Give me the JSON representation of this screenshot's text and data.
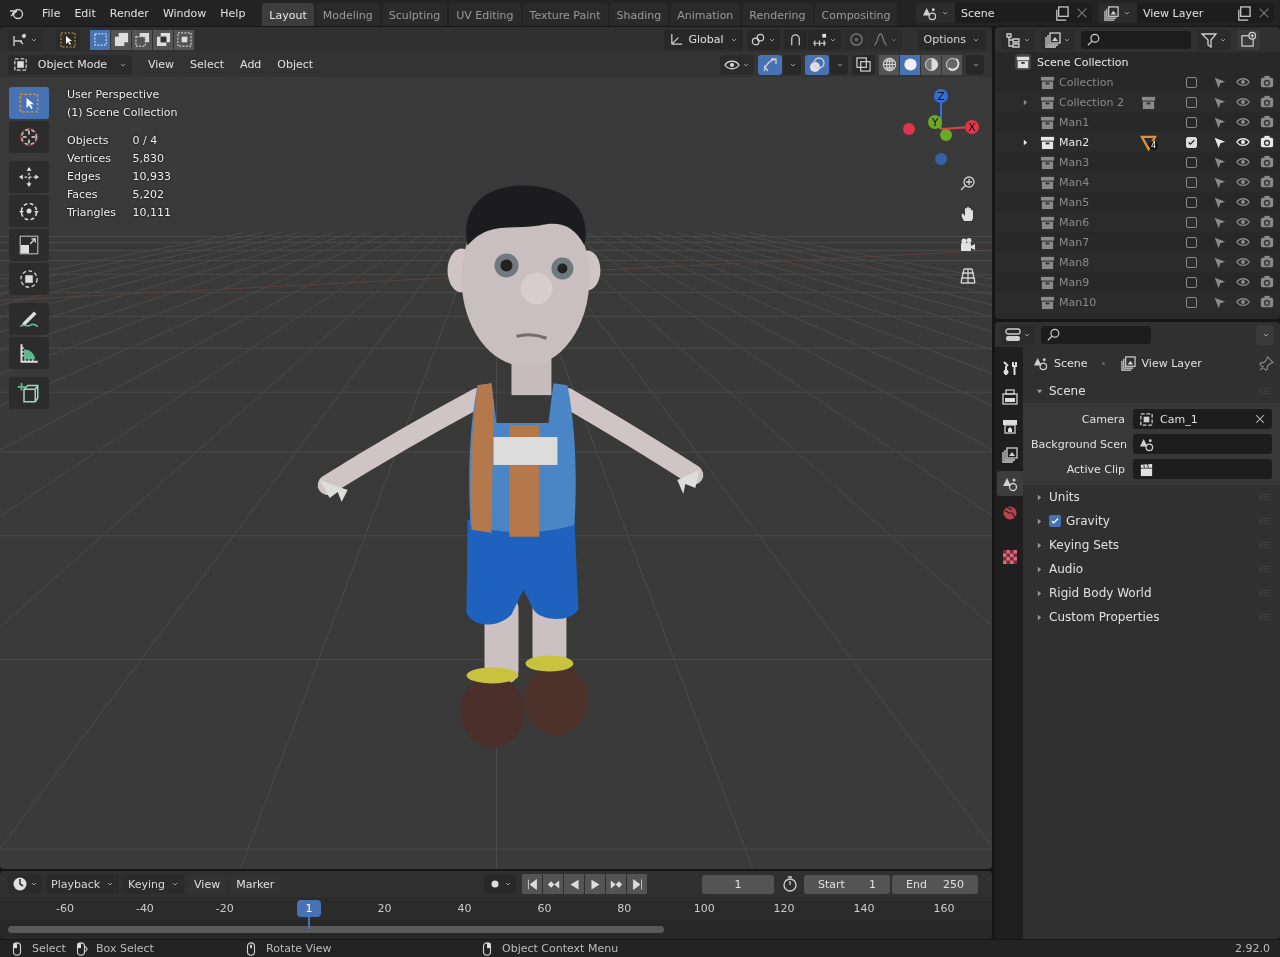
{
  "top_bar": {
    "menus": [
      "File",
      "Edit",
      "Render",
      "Window",
      "Help"
    ],
    "workspaces": [
      {
        "label": "Layout",
        "selected": true
      },
      {
        "label": "Modeling",
        "selected": false
      },
      {
        "label": "Sculpting",
        "selected": false
      },
      {
        "label": "UV Editing",
        "selected": false
      },
      {
        "label": "Texture Paint",
        "selected": false
      },
      {
        "label": "Shading",
        "selected": false
      },
      {
        "label": "Animation",
        "selected": false
      },
      {
        "label": "Rendering",
        "selected": false
      },
      {
        "label": "Compositing",
        "selected": false
      }
    ],
    "scene": "Scene",
    "view_layer": "View Layer"
  },
  "tool_header": {
    "select_modes": [
      {
        "kind": "set",
        "selected": true
      },
      {
        "kind": "extend",
        "selected": false
      },
      {
        "kind": "subtract",
        "selected": false
      },
      {
        "kind": "invert",
        "selected": false
      },
      {
        "kind": "intersect",
        "selected": false
      }
    ],
    "orientation": "Global",
    "options": "Options"
  },
  "viewport_header": {
    "mode": "Object Mode",
    "menus": [
      "View",
      "Select",
      "Add",
      "Object"
    ],
    "show_gizmos": true,
    "show_overlays": true,
    "shading": [
      {
        "kind": "wireframe",
        "selected": false
      },
      {
        "kind": "solid",
        "selected": true
      },
      {
        "kind": "material",
        "selected": false
      },
      {
        "kind": "rendered",
        "selected": false
      }
    ]
  },
  "toolbar": [
    {
      "kind": "select_box",
      "selected": true
    },
    {
      "kind": "cursor",
      "selected": false
    },
    {
      "kind": "move",
      "selected": false
    },
    {
      "kind": "rotate",
      "selected": false
    },
    {
      "kind": "scale",
      "selected": false
    },
    {
      "kind": "transform",
      "selected": false
    },
    {
      "kind": "annotate",
      "selected": false
    },
    {
      "kind": "measure",
      "selected": false
    },
    {
      "kind": "add_cube",
      "selected": false
    }
  ],
  "overlay_text": {
    "view": "User Perspective",
    "collection": "(1) Scene Collection",
    "stats": [
      {
        "label": "Objects",
        "value": "0 / 4"
      },
      {
        "label": "Vertices",
        "value": "5,830"
      },
      {
        "label": "Edges",
        "value": "10,933"
      },
      {
        "label": "Faces",
        "value": "5,202"
      },
      {
        "label": "Triangles",
        "value": "10,111"
      }
    ]
  },
  "axis_gizmo": {
    "x": "X",
    "y": "Y",
    "z": "Z"
  },
  "outliner": {
    "root": "Scene Collection",
    "items": [
      {
        "name": "Collection",
        "expander": false,
        "checked": false
      },
      {
        "name": "Collection 2",
        "expander": true,
        "checked": false,
        "extra": {
          "kind": "collection"
        }
      },
      {
        "name": "Man1",
        "expander": false,
        "checked": false
      },
      {
        "name": "Man2",
        "expander": true,
        "checked": true,
        "extra": {
          "kind": "mesh",
          "count": "4"
        }
      },
      {
        "name": "Man3",
        "expander": false,
        "checked": false
      },
      {
        "name": "Man4",
        "expander": false,
        "checked": false
      },
      {
        "name": "Man5",
        "expander": false,
        "checked": false
      },
      {
        "name": "Man6",
        "expander": false,
        "checked": false
      },
      {
        "name": "Man7",
        "expander": false,
        "checked": false
      },
      {
        "name": "Man8",
        "expander": false,
        "checked": false
      },
      {
        "name": "Man9",
        "expander": false,
        "checked": false
      },
      {
        "name": "Man10",
        "expander": false,
        "checked": false
      }
    ]
  },
  "properties": {
    "tabs": [
      {
        "kind": "tool",
        "selected": false
      },
      {
        "kind": "render",
        "selected": false
      },
      {
        "kind": "output",
        "selected": false
      },
      {
        "kind": "view_layer",
        "selected": false
      },
      {
        "kind": "scene",
        "selected": true
      },
      {
        "kind": "world",
        "selected": false
      },
      {
        "kind": "texture",
        "selected": false
      }
    ],
    "breadcrumb": [
      "Scene",
      "View Layer"
    ],
    "panels": [
      {
        "title": "Scene",
        "expanded": true,
        "fields": [
          {
            "label": "Camera",
            "kind": "camera",
            "value": "Cam_1",
            "clearable": true
          },
          {
            "label": "Background Scen",
            "kind": "scene"
          },
          {
            "label": "Active Clip",
            "kind": "clip"
          }
        ]
      },
      {
        "title": "Units",
        "expanded": false
      },
      {
        "title": "Gravity",
        "expanded": false,
        "checked": true
      },
      {
        "title": "Keying Sets",
        "expanded": false
      },
      {
        "title": "Audio",
        "expanded": false
      },
      {
        "title": "Rigid Body World",
        "expanded": false
      },
      {
        "title": "Custom Properties",
        "expanded": false
      }
    ]
  },
  "timeline": {
    "menus": [
      {
        "label": "Playback",
        "kind": "dropdown"
      },
      {
        "label": "Keying",
        "kind": "dropdown"
      },
      {
        "label": "View",
        "kind": "menu"
      },
      {
        "label": "Marker",
        "kind": "menu"
      }
    ],
    "current_frame": "1",
    "start_label": "Start",
    "start": "1",
    "end_label": "End",
    "end": "250",
    "playhead": "1",
    "ticks": [
      "-60",
      "-40",
      "-20",
      "20",
      "40",
      "60",
      "80",
      "100",
      "120",
      "140",
      "160"
    ]
  },
  "status_bar": {
    "items": [
      {
        "kind": "mouse_left",
        "text": "Select"
      },
      {
        "kind": "mouse_drag",
        "text": "Box Select"
      },
      {
        "kind": "mouse_middle",
        "text": "Rotate View"
      },
      {
        "kind": "mouse_right",
        "text": "Object Context Menu"
      }
    ],
    "version": "2.92.0"
  }
}
